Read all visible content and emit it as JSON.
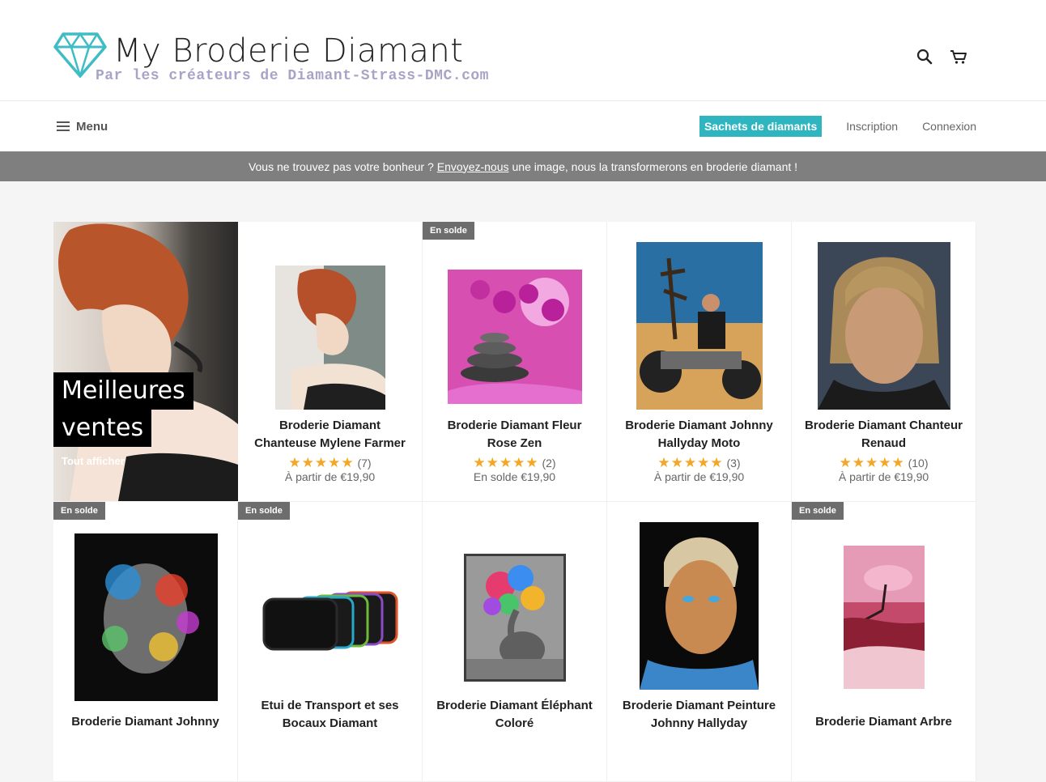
{
  "header": {
    "logo_title": "My Broderie Diamant",
    "logo_subtitle": "Par les créateurs de Diamant-Strass-DMC.com",
    "accent_color": "#2eb5bf",
    "icons": [
      "search-icon",
      "cart-icon"
    ]
  },
  "nav": {
    "menu_label": "Menu",
    "highlight_link": "Sachets de diamants",
    "links": [
      "Inscription",
      "Connexion"
    ]
  },
  "announcement": {
    "before": "Vous ne trouvez pas votre bonheur ?",
    "link": "Envoyez-nous",
    "after": "une image, nous la transformerons en broderie diamant !"
  },
  "featured": {
    "title_line1": "Meilleures",
    "title_line2": "ventes",
    "link": "Tout afficher"
  },
  "products": [
    {
      "title_line1": "Broderie Diamant",
      "title_line2": "Chanteuse Mylene Farmer",
      "stars": "★★★★★",
      "reviews": "(7)",
      "price": "À partir de €19,90",
      "badge": ""
    },
    {
      "title_line1": "Broderie Diamant Fleur",
      "title_line2": "Rose Zen",
      "stars": "★★★★★",
      "reviews": "(2)",
      "price": "En solde €19,90",
      "badge": "En solde"
    },
    {
      "title_line1": "Broderie Diamant Johnny",
      "title_line2": "Hallyday Moto",
      "stars": "★★★★★",
      "reviews": "(3)",
      "price": "À partir de €19,90",
      "badge": ""
    },
    {
      "title_line1": "Broderie Diamant Chanteur",
      "title_line2": "Renaud",
      "stars": "★★★★★",
      "reviews": "(10)",
      "price": "À partir de €19,90",
      "badge": ""
    },
    {
      "title_line1": "Broderie Diamant Johnny",
      "title_line2": "",
      "badge": "En solde"
    },
    {
      "title_line1": "Etui de Transport et ses",
      "title_line2": "Bocaux Diamant",
      "badge": "En solde"
    },
    {
      "title_line1": "Broderie Diamant Éléphant",
      "title_line2": "Coloré",
      "badge": ""
    },
    {
      "title_line1": "Broderie Diamant Peinture",
      "title_line2": "Johnny Hallyday",
      "badge": ""
    },
    {
      "title_line1": "Broderie Diamant Arbre",
      "title_line2": "",
      "badge": "En solde"
    }
  ]
}
